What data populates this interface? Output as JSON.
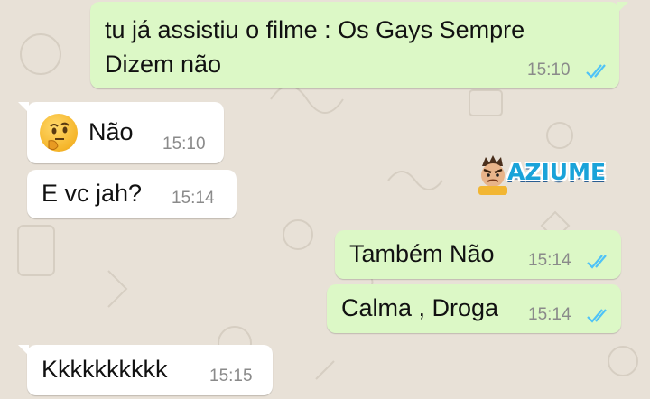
{
  "messages": [
    {
      "direction": "outgoing",
      "lines": [
        "tu já assistiu o filme : Os Gays Sempre",
        "Dizem não"
      ],
      "time": "15:10",
      "status": "read"
    },
    {
      "direction": "incoming",
      "emoji": "thinking-face",
      "text": "Não",
      "time": "15:10"
    },
    {
      "direction": "incoming",
      "text": "E vc jah?",
      "time": "15:14"
    },
    {
      "direction": "outgoing",
      "text": "Também Não",
      "time": "15:14",
      "status": "read"
    },
    {
      "direction": "outgoing",
      "text": "Calma , Droga",
      "time": "15:14",
      "status": "read"
    },
    {
      "direction": "incoming",
      "text": "Kkkkkkkkkk",
      "time": "15:15"
    }
  ],
  "watermark": {
    "text": "AZIUME"
  },
  "colors": {
    "outgoing_bubble": "#dcf8c6",
    "incoming_bubble": "#ffffff",
    "chat_background": "#e8e1d7",
    "read_ticks": "#4fc3f7",
    "timestamp": "#8a8a8a"
  }
}
